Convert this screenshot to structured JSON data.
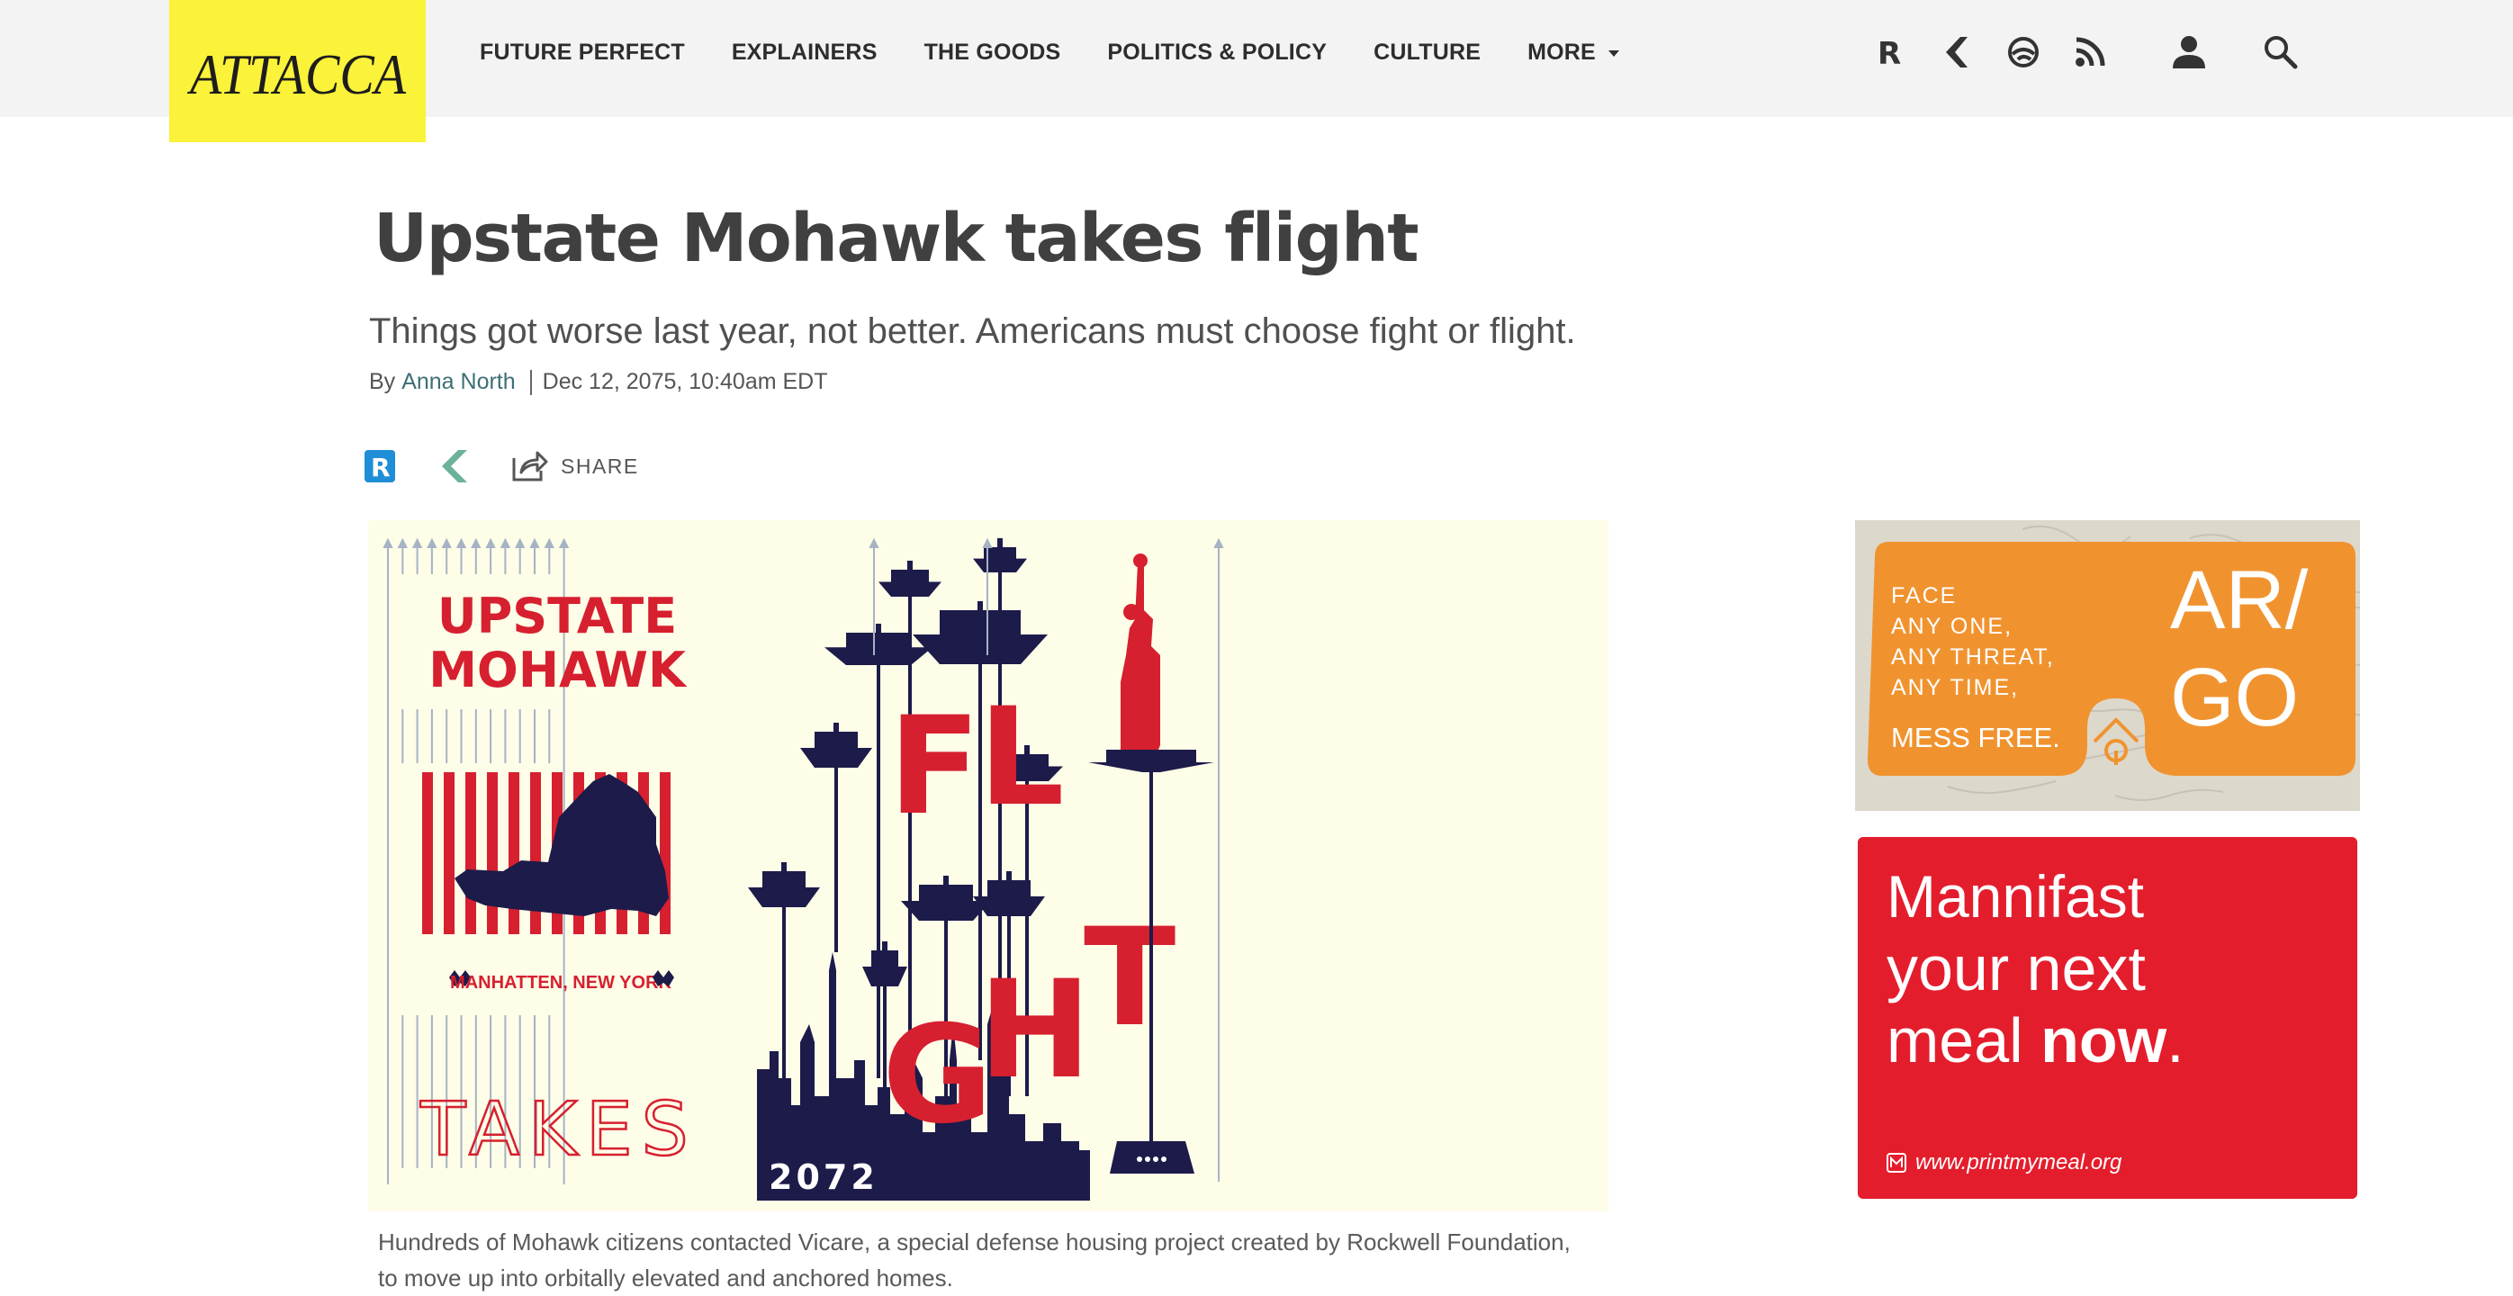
{
  "header": {
    "logo_text": "ATTACCA",
    "nav": [
      {
        "label": "FUTURE PERFECT"
      },
      {
        "label": "EXPLAINERS"
      },
      {
        "label": "THE GOODS"
      },
      {
        "label": "POLITICS & POLICY"
      },
      {
        "label": "CULTURE"
      },
      {
        "label": "MORE"
      }
    ],
    "network_icons": [
      "recode-r-icon",
      "eater-chevron-icon",
      "polygon-icon",
      "rss-icon"
    ],
    "account_icon": "user-icon",
    "search_icon": "search-icon"
  },
  "article": {
    "headline": "Upstate Mohawk takes flight",
    "dek": "Things got worse last year, not better.  Americans must choose fight or flight.",
    "byline_prefix": "By",
    "author": "Anna North",
    "timestamp": "Dec 12, 2075, 10:40am EDT",
    "share_label": "SHARE",
    "caption": "Hundreds of Mohawk citizens contacted Vicare, a special defense housing project created by Rockwell Foundation, to move up into orbitally elevated and anchored homes."
  },
  "hero": {
    "title_line1": "UPSTATE",
    "title_line2": "MOHAWK",
    "location": "MANHATTEN, NEW YORK",
    "takes": "TAKES",
    "year": "2072",
    "flight_letters": [
      "F",
      "L",
      "G",
      "H",
      "T"
    ],
    "colors": {
      "red": "#d6202f",
      "navy": "#1c1b4a",
      "cream": "#fefde8"
    }
  },
  "ads": {
    "argo": {
      "tagline_lines": [
        "FACE",
        "ANY ONE,",
        "ANY THREAT,",
        "ANY TIME,"
      ],
      "mess_free": "MESS FREE.",
      "brand_line1": "AR/",
      "brand_line2": "GO",
      "color": "#f0932f"
    },
    "mannifast": {
      "brand": "Mannifast",
      "line1": "your next",
      "line2_regular": "meal ",
      "line2_bold": "now",
      "line2_end": ".",
      "url": "www.printmymeal.org",
      "color": "#e41d2c"
    }
  }
}
